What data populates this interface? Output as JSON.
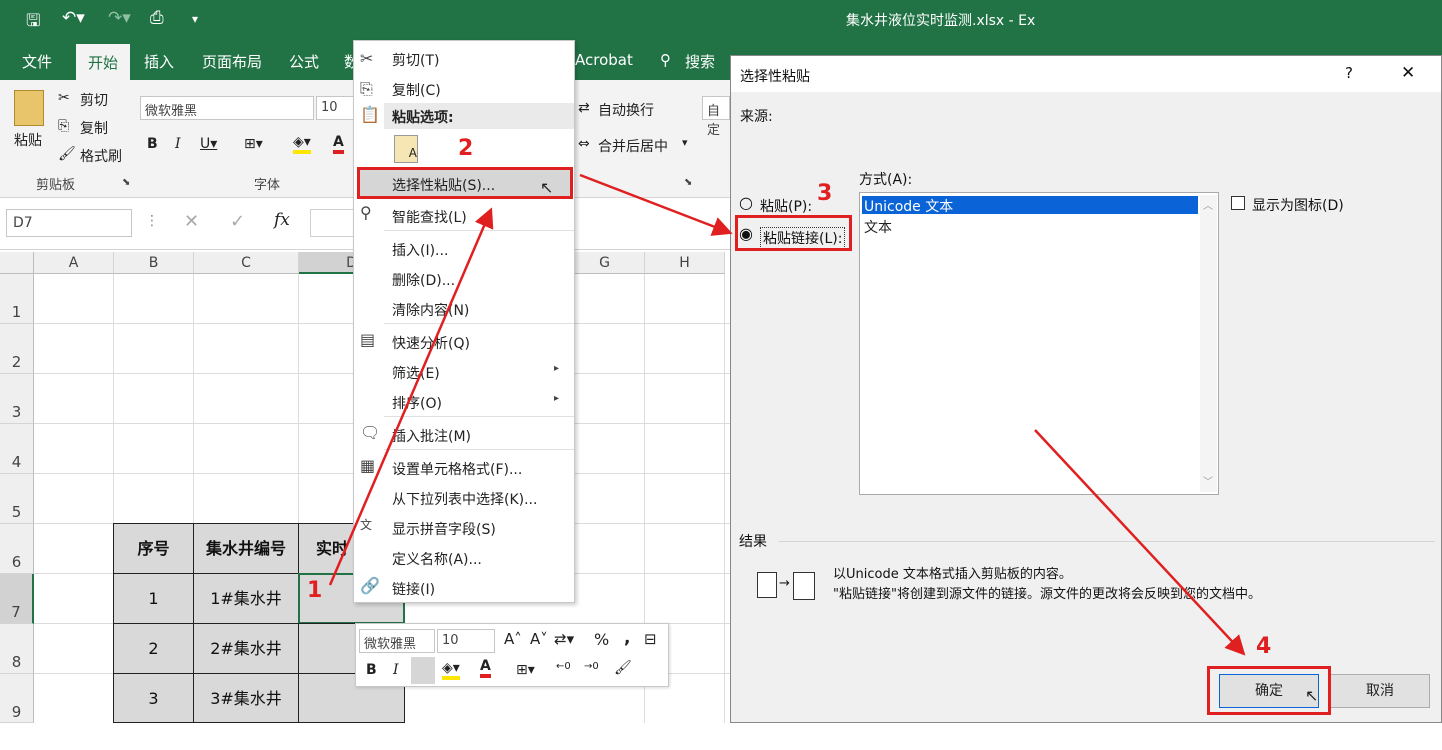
{
  "titlebar": {
    "title": "集水井液位实时监测.xlsx  -  Ex"
  },
  "tabs": [
    "文件",
    "开始",
    "插入",
    "页面布局",
    "公式",
    "数",
    "Acrobat",
    "搜索"
  ],
  "ribbon": {
    "clipboard": {
      "paste": "粘贴",
      "cut": "剪切",
      "copy": "复制",
      "format_painter": "格式刷",
      "group": "剪贴板"
    },
    "font": {
      "name": "微软雅黑",
      "size": "10",
      "group": "字体"
    },
    "alignment": {
      "wrap": "自动换行",
      "merge": "合并后居中"
    },
    "number": {
      "format": "自定"
    }
  },
  "formula_bar": {
    "name_box": "D7",
    "fx": "fx"
  },
  "sheet": {
    "columns": [
      "A",
      "B",
      "C",
      "D",
      "",
      "F",
      "G",
      "H"
    ],
    "rows": [
      "1",
      "2",
      "3",
      "4",
      "5",
      "6",
      "7",
      "8",
      "9"
    ],
    "table_headers": [
      "序号",
      "集水井编号",
      "实时"
    ],
    "table_rows": [
      [
        "1",
        "1#集水井"
      ],
      [
        "2",
        "2#集水井"
      ],
      [
        "3",
        "3#集水井"
      ]
    ]
  },
  "context_menu": {
    "items": [
      "剪切(T)",
      "复制(C)",
      "粘贴选项:",
      "选择性粘贴(S)...",
      "智能查找(L)",
      "插入(I)...",
      "删除(D)...",
      "清除内容(N)",
      "快速分析(Q)",
      "筛选(E)",
      "排序(O)",
      "插入批注(M)",
      "设置单元格格式(F)...",
      "从下拉列表中选择(K)...",
      "显示拼音字段(S)",
      "定义名称(A)...",
      "链接(I)"
    ]
  },
  "mini_toolbar": {
    "font": "微软雅黑",
    "size": "10"
  },
  "dialog": {
    "title": "选择性粘贴",
    "help": "?",
    "close": "✕",
    "source_label": "来源:",
    "as_label": "方式(A):",
    "paste_option": "粘贴(P):",
    "paste_link_option": "粘贴链接(L):",
    "list_items": [
      "Unicode 文本",
      "文本"
    ],
    "display_as_icon": "显示为图标(D)",
    "result_label": "结果",
    "result_line1": "以Unicode 文本格式插入剪贴板的内容。",
    "result_line2": "\"粘贴链接\"将创建到源文件的链接。源文件的更改将会反映到您的文档中。",
    "ok": "确定",
    "cancel": "取消"
  },
  "annotations": [
    "1",
    "2",
    "3",
    "4"
  ],
  "colors": {
    "excel_green": "#217346",
    "annotation_red": "#e02020",
    "selection_blue": "#0a64d8"
  }
}
